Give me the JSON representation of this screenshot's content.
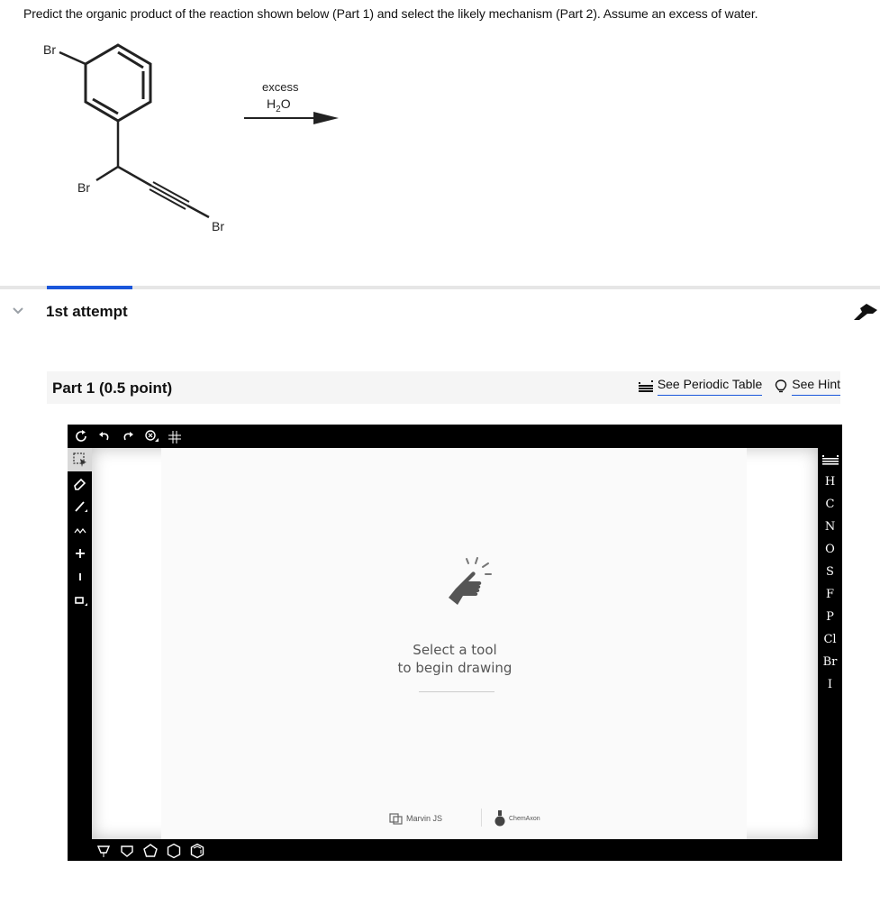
{
  "question": {
    "text": "Predict the organic product of the reaction shown below (Part 1) and select the likely mechanism (Part 2). Assume an excess of water."
  },
  "scheme": {
    "reagent_top": "excess",
    "reagent_bottom_main": "H",
    "reagent_bottom_sub": "2",
    "reagent_bottom_tail": "O",
    "br_ring": "Br",
    "br_benzylic": "Br",
    "br_alkyne": "Br"
  },
  "attempt": {
    "title": "1st attempt"
  },
  "part": {
    "title": "Part 1   (0.5 point)",
    "periodic_label": "See Periodic Table",
    "hint_label": "See Hint"
  },
  "editor": {
    "empty_line1": "Select a tool",
    "empty_line2": "to begin drawing",
    "brand_marvin": "Marvin JS",
    "brand_chem": "ChemAxon",
    "top_tools": [
      "refresh-icon",
      "undo-icon",
      "redo-icon",
      "zoom-icon",
      "2d-clean-icon"
    ],
    "left_tools": [
      "select-icon",
      "eraser-icon",
      "bond-icon",
      "chain-icon",
      "plus-charge-icon",
      "minus-charge-icon",
      "rectangle-icon"
    ],
    "elements": [
      "H",
      "C",
      "N",
      "O",
      "S",
      "F",
      "P",
      "Cl",
      "Br",
      "I"
    ],
    "bottom_tools": [
      "cyclopropane-icon",
      "cyclopentane-icon",
      "pentagon-icon",
      "hexagon-icon",
      "benzene-icon"
    ]
  },
  "colors": {
    "accent": "#1a56db",
    "editor_frame": "#000000",
    "part_bar": "#f5f5f5"
  }
}
